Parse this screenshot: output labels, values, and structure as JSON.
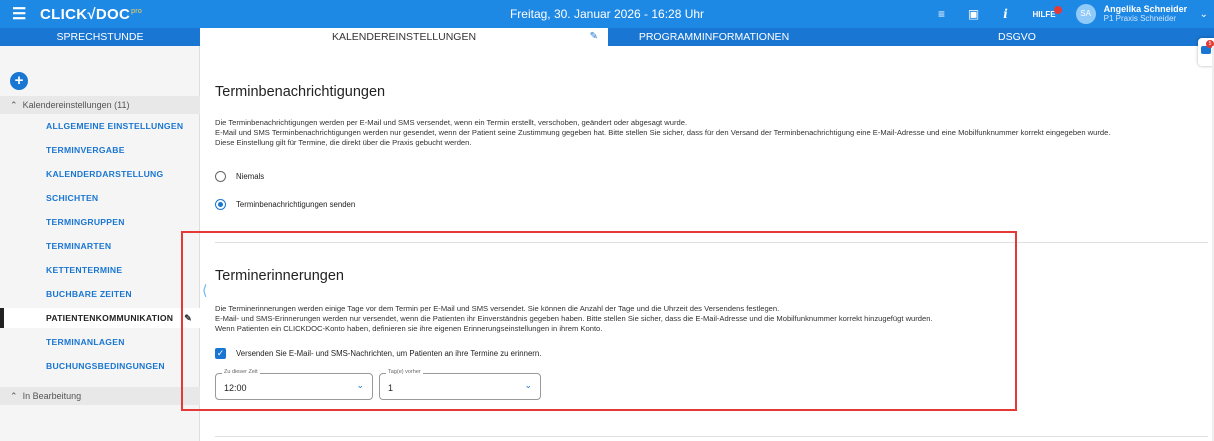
{
  "header": {
    "menu_icon": "hamburger-menu-icon",
    "logo": "CLICK√DOC",
    "logo_sup": "pro",
    "datetime": "Freitag, 30. Januar 2026 - 16:28 Uhr",
    "help_label": "HILFE",
    "user_initials": "SA",
    "user_name": "Angelika Schneider",
    "user_practice": "P1  Praxis Schneider"
  },
  "tabs": [
    "SPRECHSTUNDE",
    "KALENDEREINSTELLUNGEN",
    "PROGRAMMINFORMATIONEN",
    "DSGVO"
  ],
  "chat_badge": "5",
  "sidebar": {
    "group_label": "Kalendereinstellungen (11)",
    "items": [
      "ALLGEMEINE EINSTELLUNGEN",
      "TERMINVERGABE",
      "KALENDERDARSTELLUNG",
      "SCHICHTEN",
      "TERMINGRUPPEN",
      "TERMINARTEN",
      "KETTENTERMINE",
      "BUCHBARE ZEITEN",
      "PATIENTENKOMMUNIKATION",
      "TERMINANLAGEN",
      "BUCHUNGSBEDINGUNGEN"
    ],
    "active_item": "PATIENTENKOMMUNIKATION",
    "group2_label": "In Bearbeitung"
  },
  "notifications": {
    "title": "Terminbenachrichtigungen",
    "line1": "Die Terminbenachrichtigungen werden per E-Mail und SMS versendet, wenn ein Termin erstellt, verschoben, geändert oder abgesagt wurde.",
    "line2": "E-Mail und SMS Terminbenachrichtigungen werden nur gesendet, wenn der Patient seine Zustimmung gegeben hat. Bitte stellen Sie sicher, dass für den Versand der Terminbenachrichtigung eine E-Mail-Adresse und eine Mobilfunknummer korrekt eingegeben wurde.",
    "line3": "Diese Einstellung gilt für Termine, die direkt über die Praxis gebucht werden.",
    "option_never": "Niemals",
    "option_send": "Terminbenachrichtigungen senden",
    "selected": "Terminbenachrichtigungen senden"
  },
  "reminders": {
    "title": "Terminerinnerungen",
    "line1": "Die Terminerinnerungen werden einige Tage vor dem Termin per E-Mail und SMS versendet. Sie können die Anzahl der Tage und die Uhrzeit des Versendens festlegen.",
    "line2": "E-Mail- und SMS-Erinnerungen werden nur versendet, wenn die Patienten ihr Einverständnis gegeben haben. Bitte stellen Sie sicher, dass die E-Mail-Adresse und die Mobilfunknummer korrekt hinzugefügt wurden.",
    "line3": "Wenn Patienten ein CLICKDOC-Konto haben, definieren sie ihre eigenen Erinnerungseinstellungen in ihrem Konto.",
    "checkbox_label": "Versenden Sie E-Mail- und SMS-Nachrichten, um Patienten an ihre Termine zu erinnern.",
    "checkbox_checked": true,
    "time_label": "Zu dieser Zeit",
    "time_value": "12:00",
    "days_label": "Tag(e) vorher",
    "days_value": "1"
  },
  "colors": {
    "header": "#1e88e5",
    "tabs": "#1976d2",
    "accent": "#1976d2",
    "highlight": "#e53935"
  }
}
